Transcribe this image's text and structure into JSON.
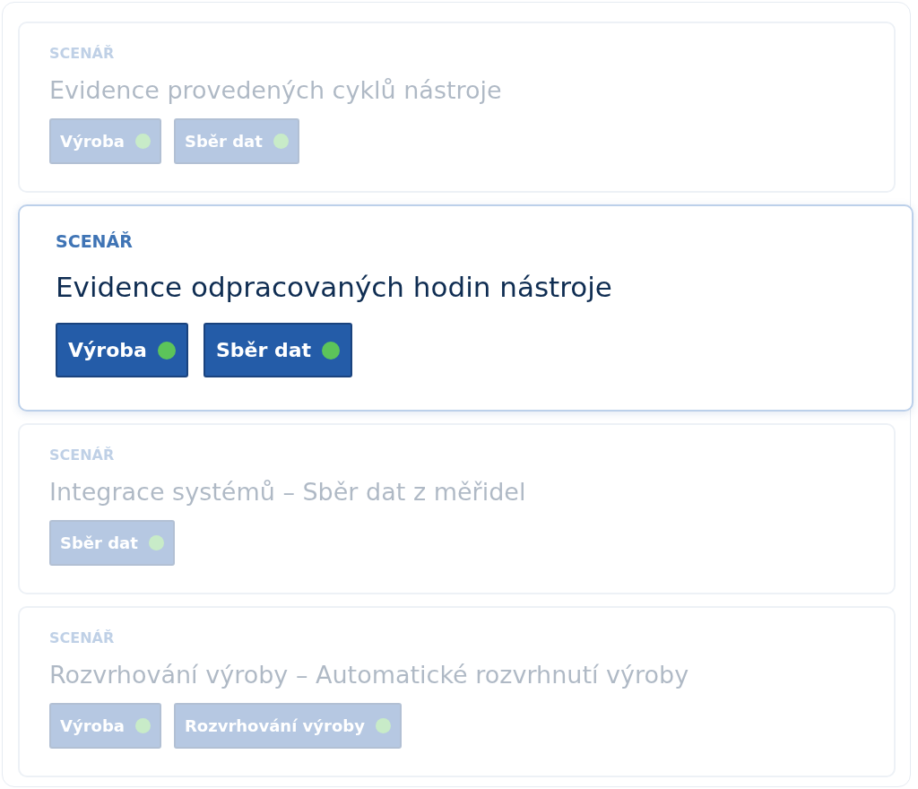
{
  "cards": [
    {
      "label": "SCENÁŘ",
      "title": "Evidence provedených cyklů nástroje",
      "selected": false,
      "tags": [
        "Výroba",
        "Sběr dat"
      ]
    },
    {
      "label": "SCENÁŘ",
      "title": "Evidence odpracovaných hodin nástroje",
      "selected": true,
      "tags": [
        "Výroba",
        "Sběr dat"
      ]
    },
    {
      "label": "SCENÁŘ",
      "title": "Integrace systémů – Sběr dat z měřidel",
      "selected": false,
      "tags": [
        "Sběr dat"
      ]
    },
    {
      "label": "SCENÁŘ",
      "title": "Rozvrhování výroby – Automatické rozvrhnutí výroby",
      "selected": false,
      "tags": [
        "Výroba",
        "Rozvrhování výroby"
      ]
    }
  ]
}
